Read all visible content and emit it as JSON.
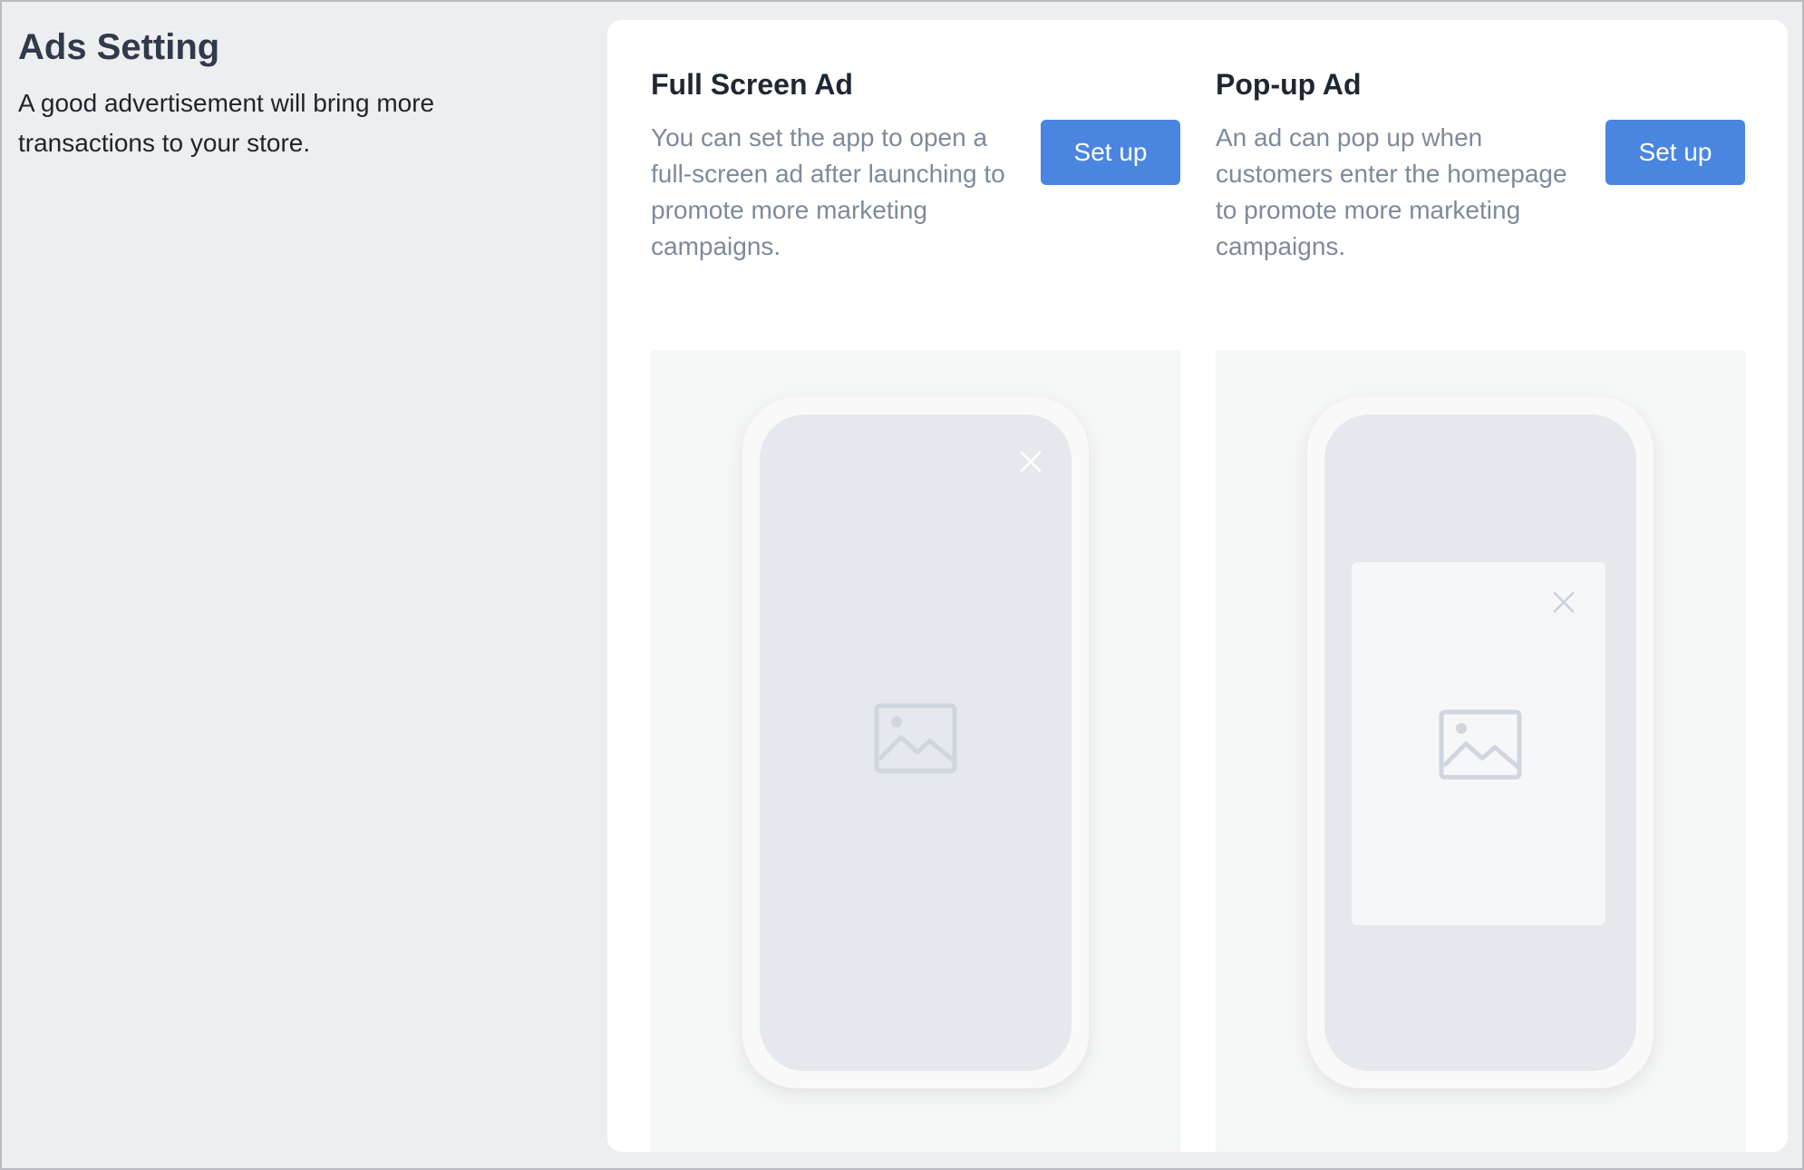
{
  "intro": {
    "title": "Ads Setting",
    "description": "A good advertisement will bring more transactions to your store."
  },
  "cards": [
    {
      "title": "Full Screen Ad",
      "description": "You can set the app to open a full-screen ad after launching to promote more marketing campaigns.",
      "button_label": "Set up"
    },
    {
      "title": "Pop-up Ad",
      "description": "An ad can pop up when customers enter the homepage to promote more marketing campaigns.",
      "button_label": "Set up"
    }
  ],
  "icons": {
    "close": "close-icon",
    "image": "image-placeholder-icon"
  },
  "colors": {
    "accent": "#4a86e0",
    "page_background": "#edeef0",
    "panel_background": "#ffffff"
  }
}
